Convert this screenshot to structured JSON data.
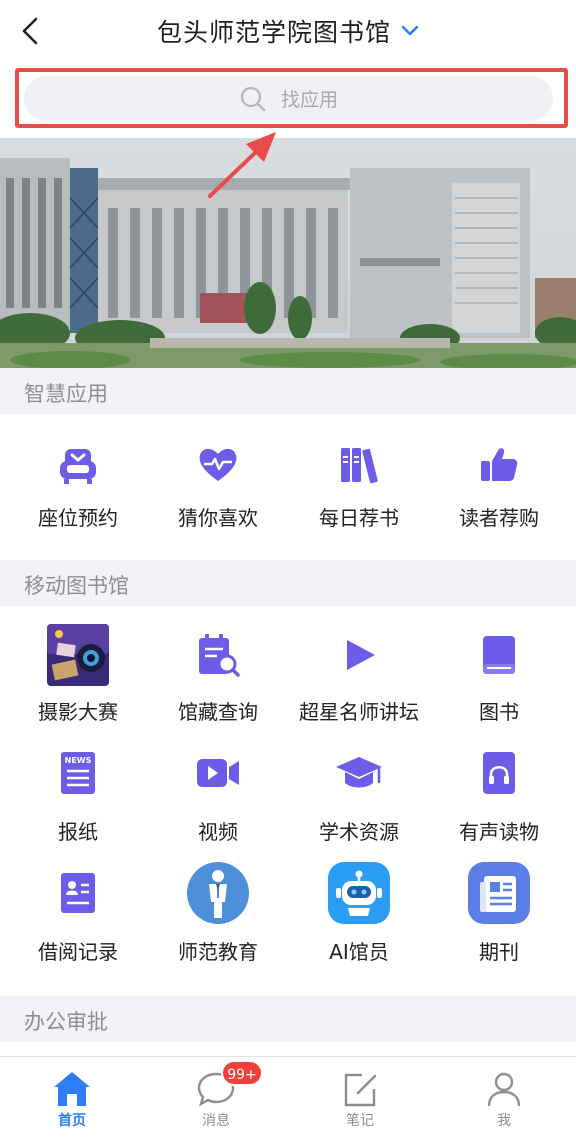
{
  "header": {
    "title": "包头师范学院图书馆"
  },
  "search": {
    "placeholder": "找应用"
  },
  "sections": [
    {
      "title": "智慧应用",
      "apps": [
        {
          "label": "座位预约",
          "icon": "seat-reservation-icon"
        },
        {
          "label": "猜你喜欢",
          "icon": "heart-icon"
        },
        {
          "label": "每日荐书",
          "icon": "bookshelf-icon"
        },
        {
          "label": "读者荐购",
          "icon": "thumbs-up-icon"
        }
      ]
    },
    {
      "title": "移动图书馆",
      "apps": [
        {
          "label": "摄影大赛",
          "icon": "photo-contest-thumbnail"
        },
        {
          "label": "馆藏查询",
          "icon": "catalog-search-icon"
        },
        {
          "label": "超星名师讲坛",
          "icon": "play-icon"
        },
        {
          "label": "图书",
          "icon": "book-icon"
        },
        {
          "label": "报纸",
          "icon": "newspaper-icon",
          "icon_text": "NEWS"
        },
        {
          "label": "视频",
          "icon": "video-camera-icon"
        },
        {
          "label": "学术资源",
          "icon": "graduation-cap-icon"
        },
        {
          "label": "有声读物",
          "icon": "audiobook-icon"
        },
        {
          "label": "借阅记录",
          "icon": "borrow-record-icon"
        },
        {
          "label": "师范教育",
          "icon": "teacher-figure-icon"
        },
        {
          "label": "AI馆员",
          "icon": "robot-icon"
        },
        {
          "label": "期刊",
          "icon": "journal-icon"
        }
      ]
    },
    {
      "title": "办公审批",
      "apps": []
    }
  ],
  "tabbar": {
    "tabs": [
      {
        "label": "首页",
        "icon": "home-icon",
        "active": true
      },
      {
        "label": "消息",
        "icon": "message-icon",
        "badge": "99+"
      },
      {
        "label": "笔记",
        "icon": "note-edit-icon"
      },
      {
        "label": "我",
        "icon": "user-icon"
      }
    ]
  },
  "colors": {
    "accent": "#6c5ce7",
    "active_tab": "#2f7df6",
    "annotation": "#e74c4c",
    "badge": "#f0403c"
  }
}
